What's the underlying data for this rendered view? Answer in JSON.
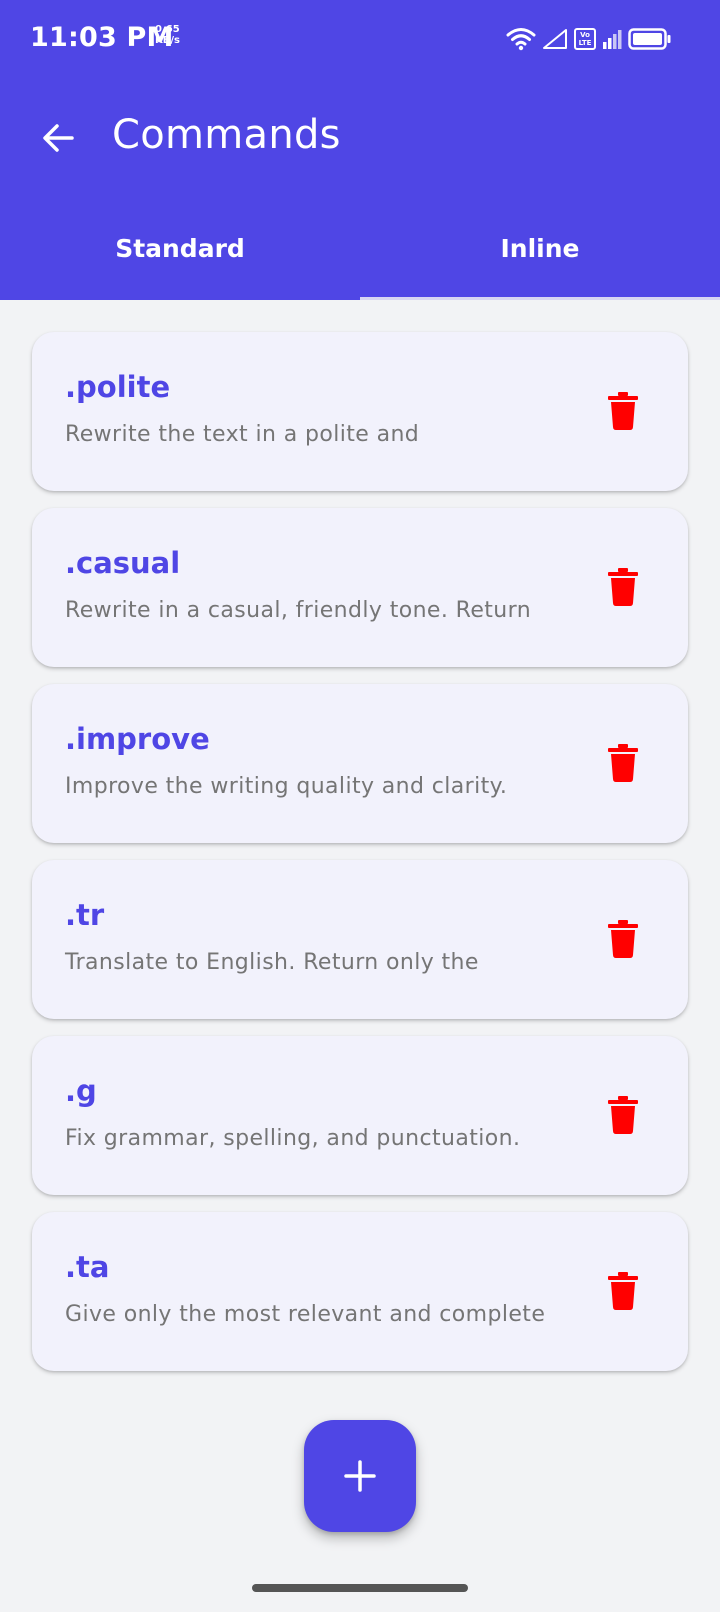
{
  "status_bar": {
    "time": "11:03 PM",
    "net_speed_value": "0.65",
    "net_speed_unit": "KB/s",
    "volte_top": "Vo",
    "volte_bottom": "LTE",
    "icons": [
      "wifi-icon",
      "signal-icon",
      "volte-icon",
      "signal-weak-icon",
      "battery-icon"
    ]
  },
  "toolbar": {
    "back_icon": "arrow-back-icon",
    "title": "Commands"
  },
  "tabs": [
    {
      "label": "Standard",
      "selected": true
    },
    {
      "label": "Inline",
      "selected": false
    }
  ],
  "commands": [
    {
      "name": ".polite",
      "description": "Rewrite the text in a polite and"
    },
    {
      "name": ".casual",
      "description": "Rewrite in a casual, friendly tone. Return"
    },
    {
      "name": ".improve",
      "description": "Improve the writing quality and clarity."
    },
    {
      "name": ".tr",
      "description": "Translate to English. Return only the"
    },
    {
      "name": ".g",
      "description": "Fix grammar, spelling, and punctuation."
    },
    {
      "name": ".ta",
      "description": "Give only the most relevant and complete"
    }
  ],
  "delete_icon": "trash-icon",
  "fab": {
    "icon": "plus-icon"
  },
  "colors": {
    "primary": "#4f46e5",
    "delete": "#ff0000",
    "background": "#f2f3f5",
    "card": "#f2f2fc",
    "description_text": "#757575"
  }
}
